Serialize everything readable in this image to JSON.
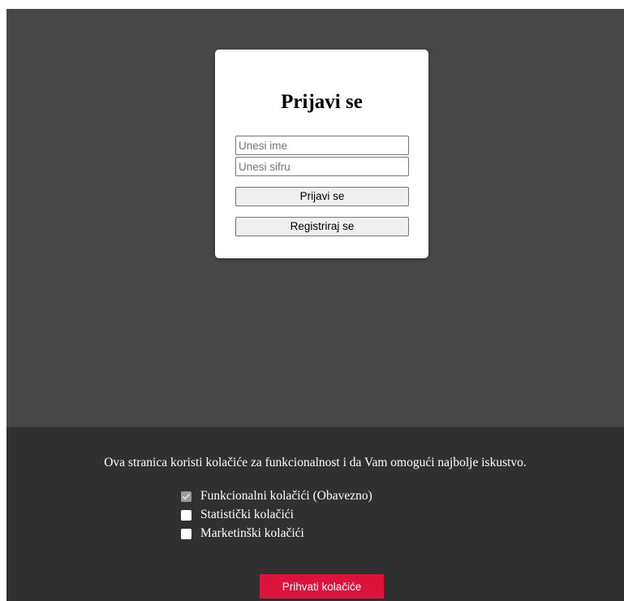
{
  "login": {
    "title": "Prijavi se",
    "name_placeholder": "Unesi ime",
    "password_placeholder": "Unesi sifru",
    "login_button": "Prijavi se",
    "register_button": "Registriraj se"
  },
  "cookies": {
    "message": "Ova stranica koristi kolačiće za funkcionalnost i da Vam omogući najbolje iskustvo.",
    "options": [
      {
        "label": "Funkcionalni kolačići (Obavezno)",
        "checked": true,
        "disabled": true
      },
      {
        "label": "Statistički kolačići",
        "checked": false,
        "disabled": false
      },
      {
        "label": "Marketinški kolačići",
        "checked": false,
        "disabled": false
      }
    ],
    "accept_button": "Prihvati kolačiće",
    "accept_color": "#dc143c"
  },
  "colors": {
    "overlay_background": "#474747",
    "cookie_bar_background": "#303030"
  }
}
